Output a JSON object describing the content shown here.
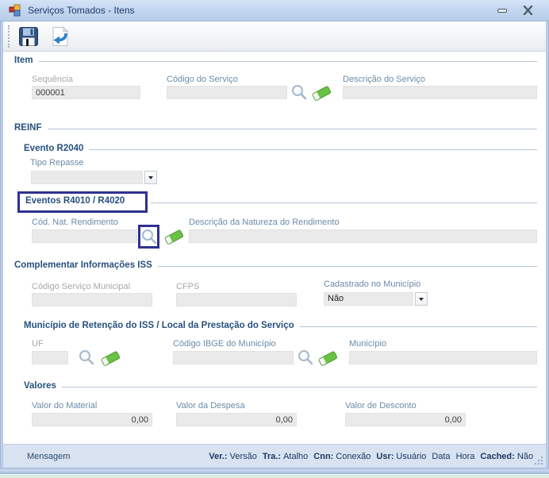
{
  "window": {
    "title": "Serviços Tomados - Itens"
  },
  "colors": {
    "highlight_box": "#2E3192",
    "header_text": "#27517E",
    "titlebar": "#C4D7F0",
    "statusbar": "#D8E2F1",
    "eraser_green": "#68C244",
    "arrow_blue": "#2F80C8"
  },
  "icons": {
    "app": "winforms-app-icon",
    "minimize": "minimize-icon",
    "close": "close-icon",
    "save": "floppy-disk-icon",
    "return": "page-return-arrow-icon",
    "search": "magnifier-icon",
    "clear": "eraser-icon"
  },
  "sections": {
    "item": {
      "title": "Item",
      "sequencia": {
        "label": "Sequência",
        "value": "000001"
      },
      "codigo_servico": {
        "label": "Código do Serviço",
        "value": ""
      },
      "descricao_servico": {
        "label": "Descrição do Serviço",
        "value": ""
      }
    },
    "reinf": {
      "title": "REINF"
    },
    "evento_r2040": {
      "title": "Evento R2040",
      "tipo_repasse": {
        "label": "Tipo Repasse",
        "value": ""
      }
    },
    "eventos_r4010_r4020": {
      "title": "Eventos R4010 / R4020",
      "cod_nat_rendimento": {
        "label": "Cód. Nat. Rendimento",
        "value": ""
      },
      "descricao_natureza": {
        "label": "Descrição da Natureza do Rendimento",
        "value": ""
      }
    },
    "complementar_iss": {
      "title": "Complementar Informações ISS",
      "codigo_servico_municipal": {
        "label": "Código Serviço Municipal",
        "value": ""
      },
      "cfps": {
        "label": "CFPS",
        "value": ""
      },
      "cadastrado_municipio": {
        "label": "Cadastrado no Município",
        "value": "Não"
      }
    },
    "municipio_retencao": {
      "title": "Município de Retenção do ISS / Local da Prestação  do Serviço",
      "uf": {
        "label": "UF",
        "value": ""
      },
      "codigo_ibge": {
        "label": "Código IBGE do Município",
        "value": ""
      },
      "municipio": {
        "label": "Município",
        "value": ""
      }
    },
    "valores": {
      "title": "Valores",
      "valor_material": {
        "label": "Valor do Material",
        "value": "0,00"
      },
      "valor_despesa": {
        "label": "Valor da Despesa",
        "value": "0,00"
      },
      "valor_desconto": {
        "label": "Valor de Desconto",
        "value": "0,00"
      }
    }
  },
  "statusbar": {
    "message": "Mensagem",
    "right": [
      {
        "label": "Ver.:",
        "value": "Versão"
      },
      {
        "label": "Tra.:",
        "value": "Atalho"
      },
      {
        "label": "Cnn:",
        "value": "Conexão"
      },
      {
        "label": "Usr:",
        "value": "Usuário"
      },
      {
        "label": "",
        "value": "Data"
      },
      {
        "label": "",
        "value": "Hora"
      },
      {
        "label": "Cached:",
        "value": "Não"
      }
    ]
  }
}
